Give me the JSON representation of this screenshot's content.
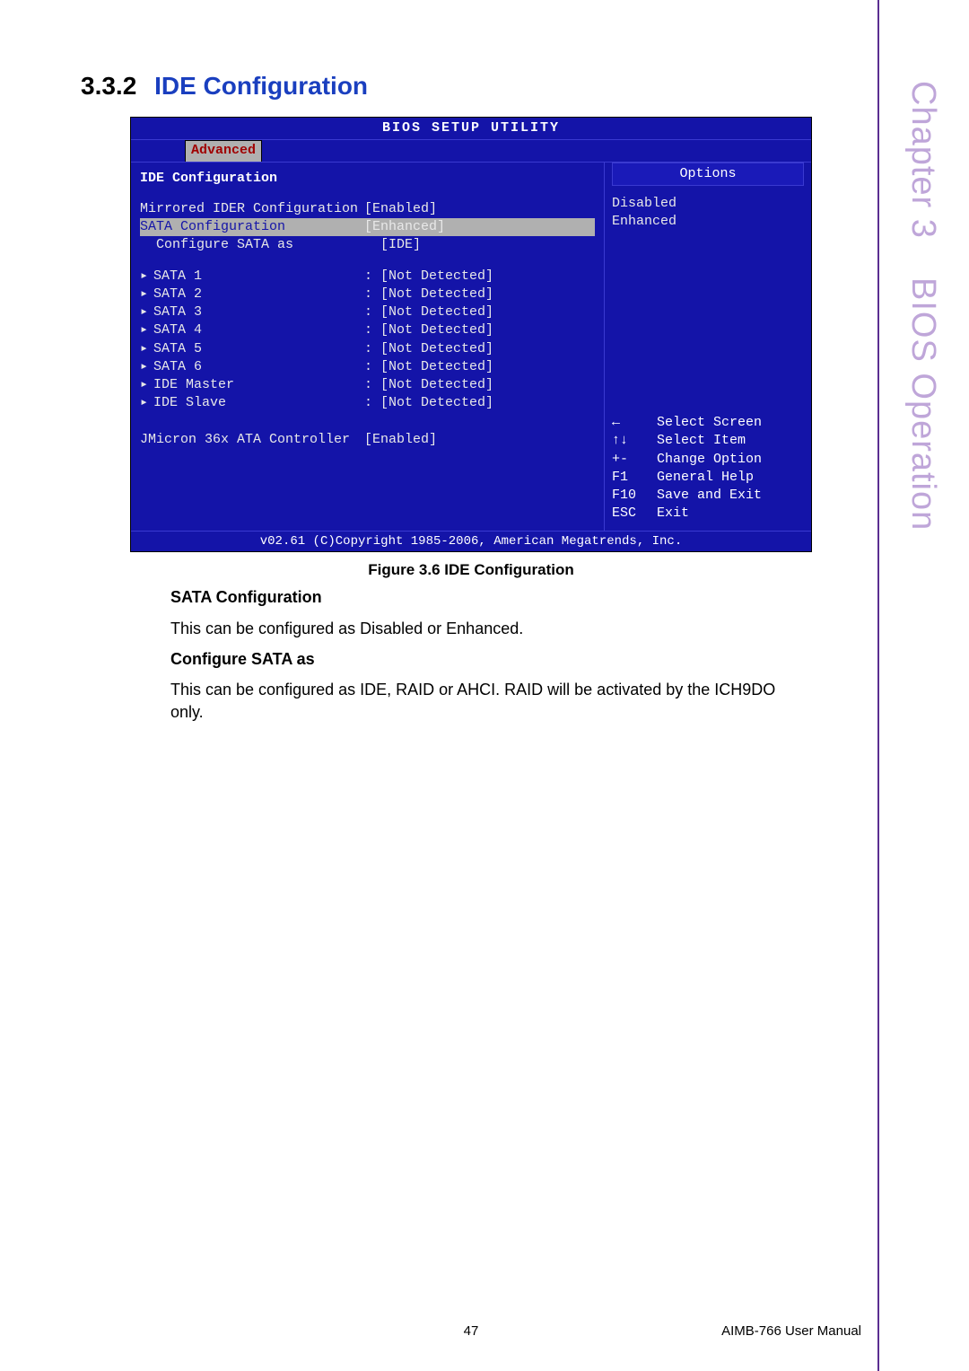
{
  "section_number": "3.3.2",
  "section_title": "IDE Configuration",
  "side_tab": {
    "chapter": "Chapter 3",
    "title": "BIOS Operation"
  },
  "bios": {
    "title": "BIOS SETUP UTILITY",
    "tab": "Advanced",
    "left_title": "IDE Configuration",
    "config_rows": [
      {
        "label": "Mirrored IDER Configuration",
        "value": "[Enabled]",
        "highlight": false,
        "indent": false
      },
      {
        "label": "SATA Configuration",
        "value": "[Enhanced]",
        "highlight": true,
        "indent": false
      },
      {
        "label": "Configure SATA as",
        "value": "[IDE]",
        "highlight": false,
        "indent": true
      }
    ],
    "device_rows": [
      {
        "label": "SATA 1",
        "value": "[Not Detected]"
      },
      {
        "label": "SATA 2",
        "value": "[Not Detected]"
      },
      {
        "label": "SATA 3",
        "value": "[Not Detected]"
      },
      {
        "label": "SATA 4",
        "value": "[Not Detected]"
      },
      {
        "label": "SATA 5",
        "value": "[Not Detected]"
      },
      {
        "label": "SATA 6",
        "value": "[Not Detected]"
      },
      {
        "label": "IDE Master",
        "value": "[Not Detected]"
      },
      {
        "label": "IDE Slave",
        "value": "[Not Detected]"
      }
    ],
    "extra_row": {
      "label": "JMicron 36x ATA Controller",
      "value": "[Enabled]"
    },
    "right_title": "Options",
    "options": [
      "Disabled",
      "Enhanced"
    ],
    "nav": [
      {
        "key": "←",
        "text": "Select Screen"
      },
      {
        "key": "↑↓",
        "text": "Select Item"
      },
      {
        "key": "+-",
        "text": "Change Option"
      },
      {
        "key": "F1",
        "text": "General Help"
      },
      {
        "key": "F10",
        "text": "Save and Exit"
      },
      {
        "key": "ESC",
        "text": "Exit"
      }
    ],
    "footer": "v02.61 (C)Copyright 1985-2006, American Megatrends, Inc."
  },
  "figure_caption": "Figure 3.6 IDE Configuration",
  "body": {
    "h1": "SATA Configuration",
    "p1": "This can be configured as Disabled or Enhanced.",
    "h2": "Configure SATA as",
    "p2": "This can be configured as IDE, RAID or AHCI. RAID will be activated by the ICH9DO only."
  },
  "footer": {
    "page": "47",
    "manual": "AIMB-766 User Manual"
  }
}
